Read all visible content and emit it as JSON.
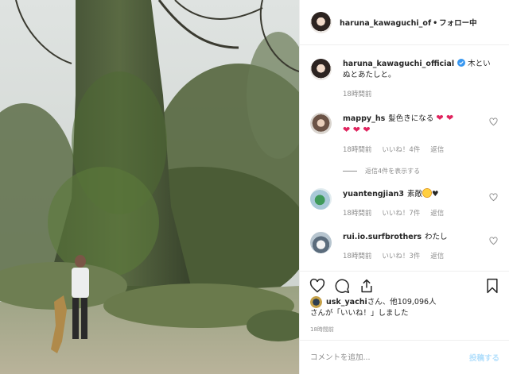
{
  "header": {
    "username": "haruna_kawaguchi_of",
    "separator": "•",
    "follow_label": "フォロー中"
  },
  "caption": {
    "username": "haruna_kawaguchi_official",
    "text": "木といぬとあたしと。",
    "time": "18時間前"
  },
  "comments": [
    {
      "username": "mappy_hs",
      "text": "髪色きになる",
      "hearts_line1": "❤ ❤",
      "hearts_line2": "❤ ❤ ❤",
      "time": "18時間前",
      "likes": "いいね！4件",
      "reply": "返信",
      "view_replies": "返信4件を表示する"
    },
    {
      "username": "yuantengjian3",
      "text": "素敵",
      "trail": "♥",
      "time": "18時間前",
      "likes": "いいね！7件",
      "reply": "返信"
    },
    {
      "username": "rui.io.surfbrothers",
      "text": "わたし",
      "time": "18時間前",
      "likes": "いいね！3件",
      "reply": "返信"
    }
  ],
  "likes": {
    "username": "usk_yachi",
    "suffix": "さん、他109,096人",
    "line2": "さんが「いいね！」しました"
  },
  "post_time": "18時間前",
  "add_comment": {
    "placeholder": "コメントを追加...",
    "post_label": "投稿する"
  },
  "colors": {
    "accent": "#0095f6",
    "disabled_post": "#b2dffc",
    "muted": "#8e8e8e",
    "verified": "#3897f0",
    "heart": "#e0245e"
  },
  "icons": [
    "heart-icon",
    "comment-icon",
    "share-icon",
    "bookmark-icon",
    "verified-badge-icon",
    "like-heart-icon"
  ]
}
